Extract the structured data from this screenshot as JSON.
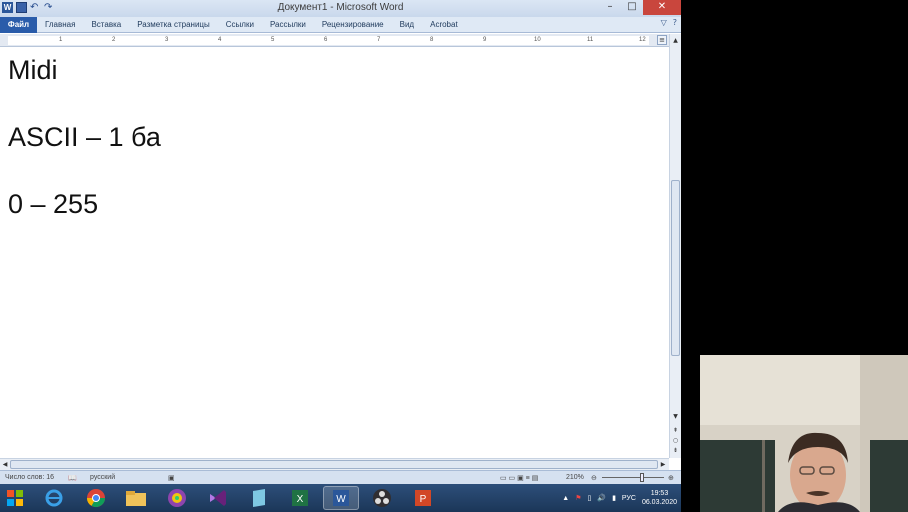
{
  "window": {
    "title": "Документ1 - Microsoft Word",
    "minimize_label": "–",
    "maximize_label": "□",
    "close_label": "✕"
  },
  "qat": {
    "undo_label": "↶",
    "redo_label": "↷"
  },
  "ribbon": {
    "tabs": [
      "Файл",
      "Главная",
      "Вставка",
      "Разметка страницы",
      "Ссылки",
      "Рассылки",
      "Рецензирование",
      "Вид",
      "Acrobat"
    ],
    "help_label": "?"
  },
  "ruler": {
    "numbers": [
      "1",
      "2",
      "3",
      "4",
      "5",
      "6",
      "7",
      "8",
      "9",
      "10",
      "11",
      "12"
    ]
  },
  "document": {
    "lines": [
      "Midi",
      "ASCII – 1 ба",
      "0 – 255"
    ]
  },
  "statusbar": {
    "word_count": "Число слов: 16",
    "language": "русский",
    "zoom": "210%",
    "zoom_out": "⊖",
    "zoom_in": "⊕"
  },
  "taskbar": {
    "icons": [
      "windows-start-icon",
      "internet-explorer-icon",
      "chrome-icon",
      "file-explorer-icon",
      "picasa-icon",
      "visual-studio-icon",
      "notepad-icon",
      "excel-icon",
      "word-icon",
      "obs-icon",
      "powerpoint-icon"
    ],
    "active": "word-icon"
  },
  "tray": {
    "language": "РУС",
    "time": "19:53",
    "date": "06.03.2020"
  },
  "colors": {
    "ribbon_accent": "#2a5caa",
    "taskbar": "#1b3658",
    "close_button": "#c9463d"
  }
}
